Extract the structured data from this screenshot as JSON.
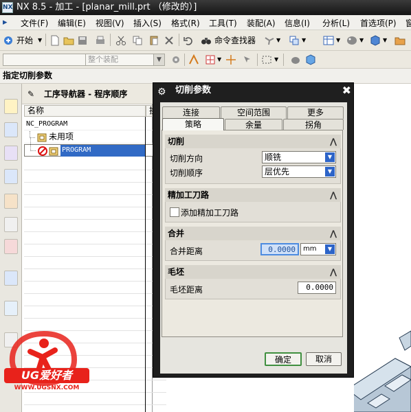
{
  "window": {
    "logo": "NX",
    "title": "NX 8.5 - 加工 - [planar_mill.prt （修改的）]"
  },
  "menu": [
    "文件(F)",
    "编辑(E)",
    "视图(V)",
    "插入(S)",
    "格式(R)",
    "工具(T)",
    "装配(A)",
    "信息(I)",
    "分析(L)",
    "首选项(P)",
    "窗"
  ],
  "toolbar": {
    "start_label": "开始",
    "command_finder_label": "命令查找器",
    "selection_filter_placeholder": "",
    "assembly_filter_placeholder": "整个装配"
  },
  "cue_line": "指定切削参数",
  "navigator": {
    "title": "工序导航器 - 程序顺序",
    "col_name": "名称",
    "col_tool_change": "换刀",
    "rows": [
      {
        "label": "NC_PROGRAM"
      },
      {
        "label": "未用项"
      },
      {
        "label": "PROGRAM"
      }
    ]
  },
  "dialog": {
    "title": "切削参数",
    "tabs_row1": [
      "连接",
      "空间范围",
      "更多"
    ],
    "tabs_row2": [
      "策略",
      "余量",
      "拐角"
    ],
    "active_tab": "策略",
    "groups": {
      "cutting": {
        "title": "切削",
        "cut_direction_label": "切削方向",
        "cut_direction_value": "顺铣",
        "cut_order_label": "切削顺序",
        "cut_order_value": "层优先"
      },
      "finish_pass": {
        "title": "精加工刀路",
        "add_finish_label": "添加精加工刀路",
        "add_finish_checked": false
      },
      "merge": {
        "title": "合并",
        "merge_distance_label": "合并距离",
        "merge_distance_value": "0.0000",
        "unit": "mm"
      },
      "blank": {
        "title": "毛坯",
        "blank_distance_label": "毛坯距离",
        "blank_distance_value": "0.0000"
      }
    },
    "ok_label": "确定",
    "cancel_label": "取消"
  },
  "watermark": {
    "brand": "UG爱好者",
    "url": "WWW.UGSNX.COM"
  }
}
